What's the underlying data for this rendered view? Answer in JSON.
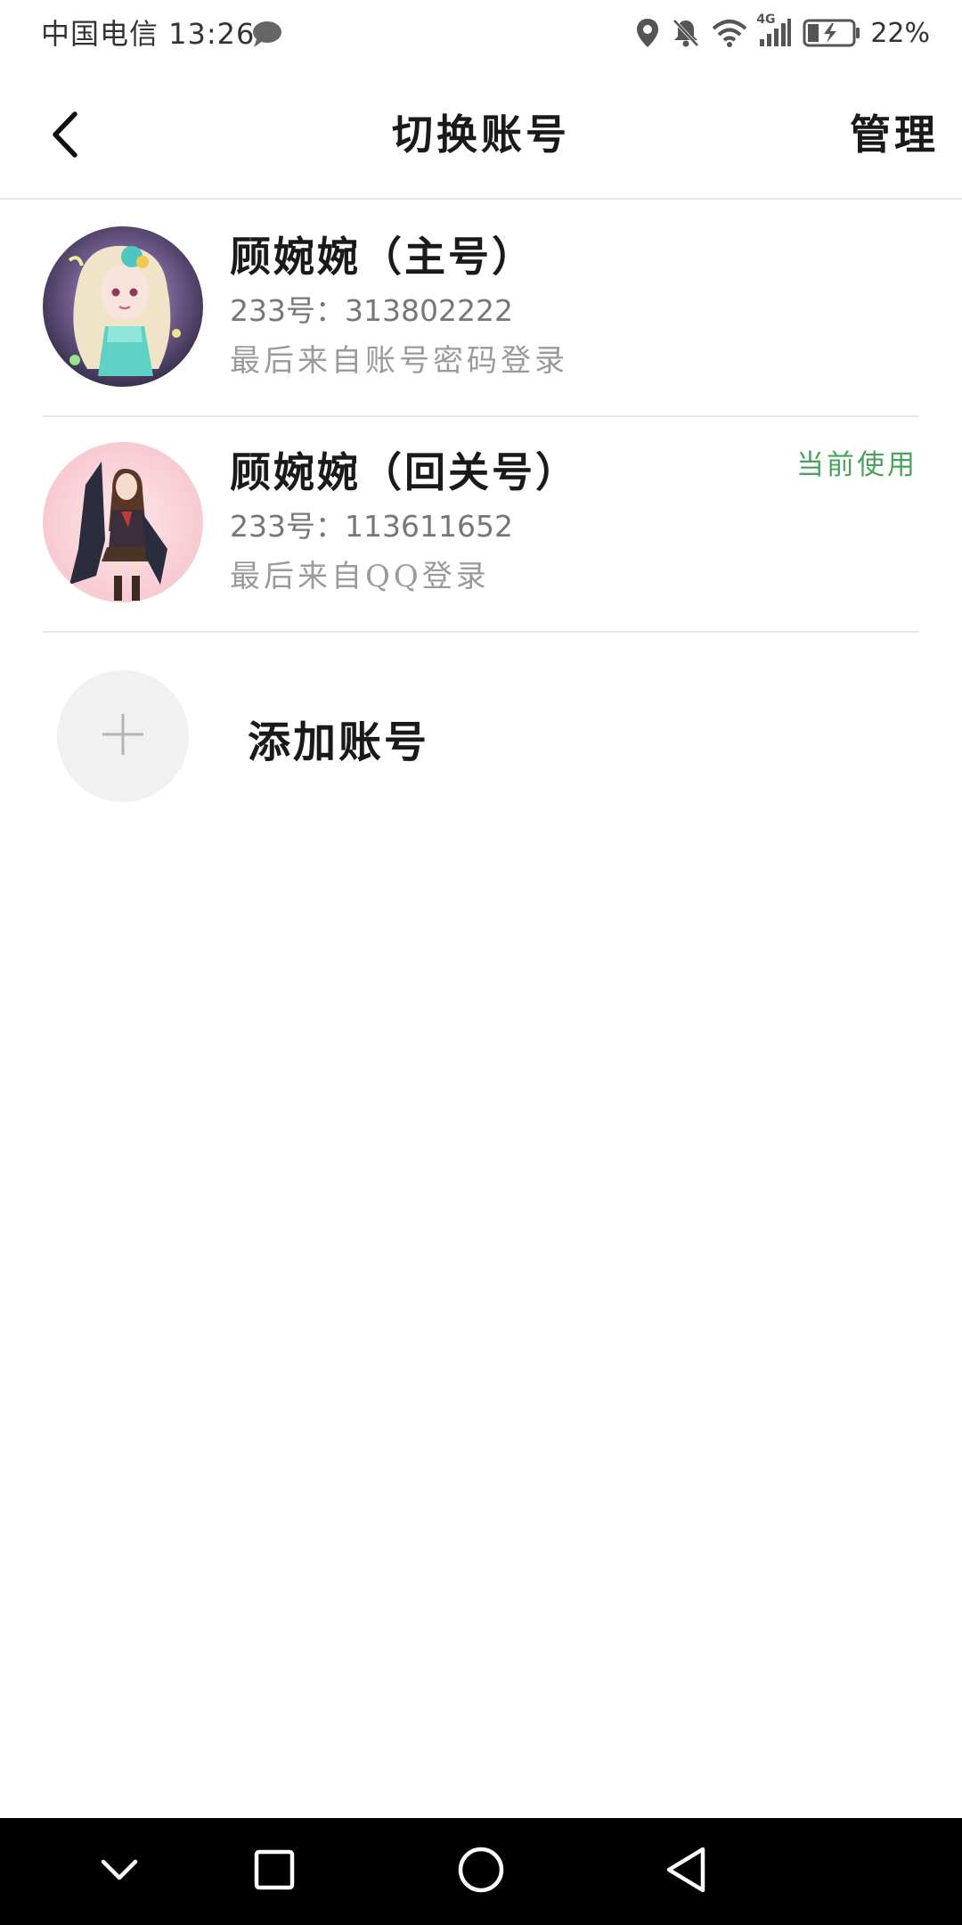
{
  "status_bar": {
    "carrier_time": "中国电信 13:26",
    "network": "4G",
    "battery": "22%",
    "icons": [
      "message-icon",
      "location-icon",
      "bell-off-icon",
      "wifi-icon",
      "signal-icon",
      "battery-charging-icon"
    ]
  },
  "header": {
    "title": "切换账号",
    "manage_label": "管理",
    "back_icon": "back-arrow-icon"
  },
  "accounts": [
    {
      "name": "顾婉婉（主号）",
      "id_line": "233号：313802222",
      "login_line": "最后来自账号密码登录",
      "current": false
    },
    {
      "name": "顾婉婉（回关号）",
      "id_line": "233号：113611652",
      "login_line": "最后来自QQ登录",
      "current": true,
      "current_label": "当前使用"
    }
  ],
  "add_account": {
    "label": "添加账号",
    "icon": "plus-icon"
  },
  "nav_bar": {
    "icons": [
      "collapse-chevron-icon",
      "recents-square-icon",
      "home-circle-icon",
      "back-triangle-icon"
    ]
  },
  "colors": {
    "accent_green": "#4aa35c",
    "divider": "#e5e5e5",
    "secondary_text": "#777777",
    "tertiary_text": "#9a9a9a"
  }
}
